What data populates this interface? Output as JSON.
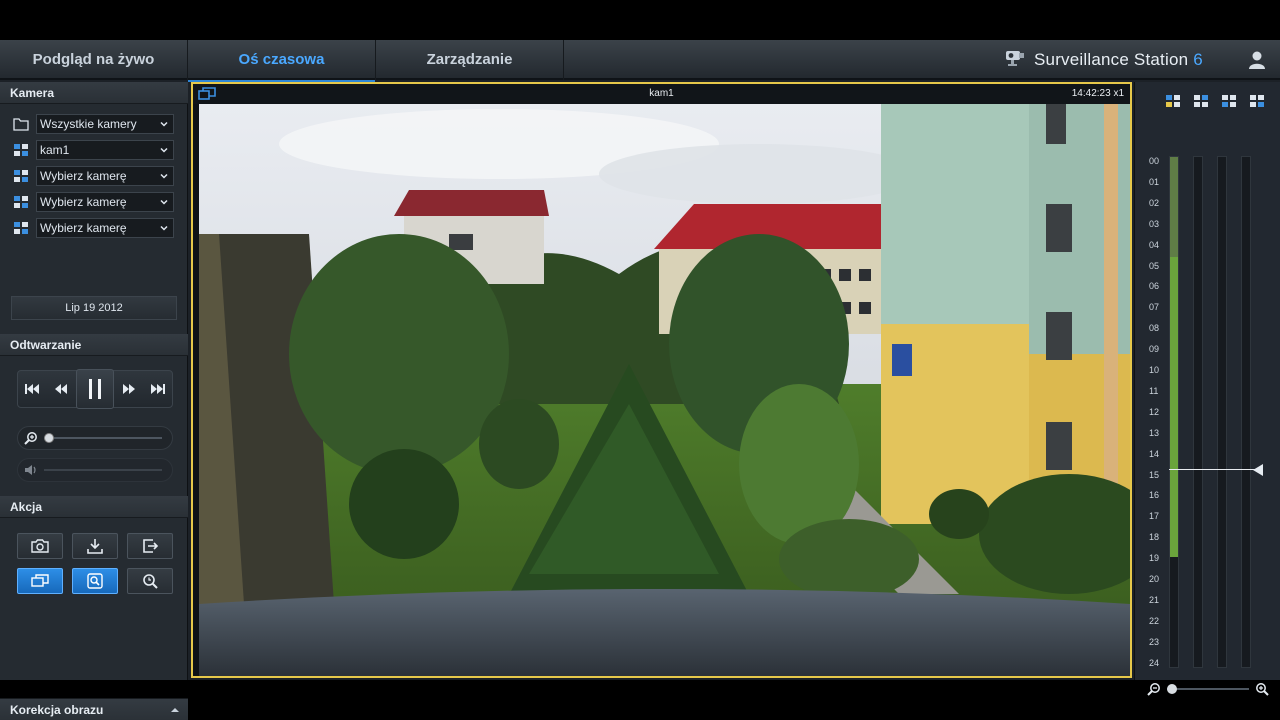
{
  "nav": {
    "tabs": [
      {
        "label": "Podgląd na żywo",
        "active": false
      },
      {
        "label": "Oś czasowa",
        "active": true
      },
      {
        "label": "Zarządzanie",
        "active": false
      }
    ],
    "brand": "Surveillance Station",
    "brand_version": "6",
    "user_icon": "user-icon"
  },
  "sidebar": {
    "camera_title": "Kamera",
    "camera_selects": [
      {
        "icon": "folder-icon",
        "value": "Wszystkie kamery"
      },
      {
        "icon": "camera-layout-icon",
        "value": "kam1"
      },
      {
        "icon": "camera-layout-icon",
        "value": "Wybierz kamerę"
      },
      {
        "icon": "camera-layout-icon",
        "value": "Wybierz kamerę"
      },
      {
        "icon": "camera-layout-icon",
        "value": "Wybierz kamerę"
      }
    ],
    "date": "Lip 19 2012",
    "playback_title": "Odtwarzanie",
    "zoom_level": 0,
    "volume_level": 0,
    "action_title": "Akcja",
    "image_correction_title": "Korekcja obrazu"
  },
  "video": {
    "camera_name": "kam1",
    "timestamp": "14:42:23 x1"
  },
  "timeline": {
    "hours": [
      "00",
      "01",
      "02",
      "03",
      "04",
      "05",
      "06",
      "07",
      "08",
      "09",
      "10",
      "11",
      "12",
      "13",
      "14",
      "15",
      "16",
      "17",
      "18",
      "19",
      "20",
      "21",
      "22",
      "23",
      "24"
    ],
    "current_hour": 15,
    "recording_color": "#6aa43c",
    "accent_color": "#4aa8ff",
    "highlight_color": "#e6c84a"
  }
}
